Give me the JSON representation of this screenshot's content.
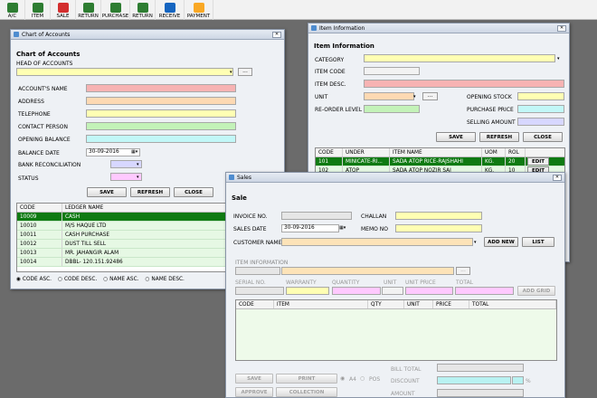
{
  "toolbar": [
    {
      "label": "A/C",
      "color": "#2e7d32"
    },
    {
      "label": "ITEM",
      "color": "#2e7d32"
    },
    {
      "label": "SALE",
      "color": "#d32f2f"
    },
    {
      "label": "RETURN",
      "color": "#2e7d32"
    },
    {
      "label": "PURCHASE",
      "color": "#2e7d32"
    },
    {
      "label": "RETURN",
      "color": "#2e7d32"
    },
    {
      "label": "RECEIVE",
      "color": "#1565c0"
    },
    {
      "label": "PAYMENT",
      "color": "#f9a825"
    }
  ],
  "coa": {
    "window_title": "Chart of Accounts",
    "heading": "Chart of Accounts",
    "head_label": "HEAD OF ACCOUNTS",
    "account_name": "ACCOUNT'S NAME",
    "address": "ADDRESS",
    "telephone": "TELEPHONE",
    "contact": "CONTACT PERSON",
    "opening": "OPENING BALANCE",
    "balance_date": "BALANCE DATE",
    "balance_date_value": "30-09-2016",
    "bank_rec": "BANK RECONCILIATION",
    "status": "STATUS",
    "save": "SAVE",
    "refresh": "REFRESH",
    "close": "CLOSE",
    "columns": [
      "CODE",
      "LEDGER NAME"
    ],
    "rows": [
      [
        "10009",
        "CASH"
      ],
      [
        "10010",
        "M/S HAQUE LTD"
      ],
      [
        "10011",
        "CASH PURCHASE"
      ],
      [
        "10012",
        "DUST TILL SELL"
      ],
      [
        "10013",
        "MR. JAHANGIR ALAM"
      ],
      [
        "10014",
        "DBBL- 120.151.92486"
      ]
    ],
    "sort": [
      "CODE ASC.",
      "CODE DESC.",
      "NAME ASC.",
      "NAME DESC."
    ]
  },
  "item": {
    "window_title": "Item Information",
    "heading": "Item Information",
    "category": "CATEGORY",
    "code": "ITEM CODE",
    "desc": "ITEM DESC.",
    "unit": "UNIT",
    "reorder": "RE-ORDER LEVEL",
    "opening_stock": "OPENING STOCK",
    "purchase_price": "PURCHASE PRICE",
    "selling_amount": "SELLING AMOUNT",
    "save": "SAVE",
    "refresh": "REFRESH",
    "close": "CLOSE",
    "columns": [
      "CODE",
      "UNDER",
      "ITEM NAME",
      "UOM",
      "ROL"
    ],
    "rows": [
      [
        "101",
        "MINICATE-RI...",
        "SADA ATOP RICE-RAJSHAHI",
        "KG.",
        "20"
      ],
      [
        "102",
        "ATOP",
        "SADA ATOP NOZIR SAI",
        "KG.",
        "10"
      ]
    ],
    "edit": "EDIT"
  },
  "sales": {
    "window_title": "Sales",
    "heading": "Sale",
    "invoice": "INVOICE NO.",
    "sales_date": "SALES DATE",
    "sales_date_value": "30-09-2016",
    "customer": "CUSTOMER NAME",
    "challan": "CHALLAN",
    "memo": "MEMO NO",
    "add_new": "ADD NEW",
    "list": "LIST",
    "item_info": "ITEM INFORMATION",
    "serial": "SERIAL NO.",
    "warranty": "WARRANTY",
    "quantity": "QUANTITY",
    "unit": "UNIT",
    "unit_price": "UNIT PRICE",
    "total": "TOTAL",
    "add_grid": "ADD GRID",
    "columns": [
      "CODE",
      "ITEM",
      "QTY",
      "UNIT",
      "PRICE",
      "TOTAL"
    ],
    "save": "SAVE",
    "print": "PRINT",
    "a4": "A4",
    "pos": "POS",
    "approve": "APPROVE",
    "collection": "COLLECTION",
    "bill_total": "BILL TOTAL",
    "discount": "DISCOUNT",
    "pct": "%",
    "amount": "AMOUNT"
  }
}
